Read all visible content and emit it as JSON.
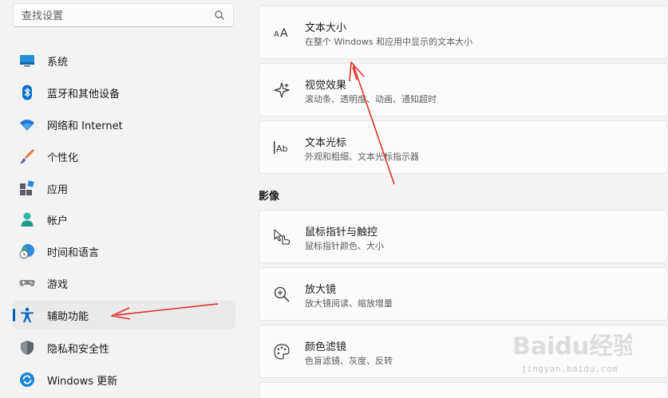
{
  "search": {
    "placeholder": "查找设置"
  },
  "sidebar": {
    "items": [
      {
        "label": "系统",
        "icon": "display-icon"
      },
      {
        "label": "蓝牙和其他设备",
        "icon": "bluetooth-icon"
      },
      {
        "label": "网络和 Internet",
        "icon": "wifi-icon"
      },
      {
        "label": "个性化",
        "icon": "brush-icon"
      },
      {
        "label": "应用",
        "icon": "apps-icon"
      },
      {
        "label": "帐户",
        "icon": "person-icon"
      },
      {
        "label": "时间和语言",
        "icon": "globe-clock-icon"
      },
      {
        "label": "游戏",
        "icon": "gamepad-icon"
      },
      {
        "label": "辅助功能",
        "icon": "accessibility-icon",
        "selected": true
      },
      {
        "label": "隐私和安全性",
        "icon": "shield-icon"
      },
      {
        "label": "Windows 更新",
        "icon": "update-icon"
      }
    ]
  },
  "main": {
    "cards_top": [
      {
        "title": "文本大小",
        "subtitle": "在整个 Windows 和应用中显示的文本大小",
        "icon": "text-size-icon"
      },
      {
        "title": "视觉效果",
        "subtitle": "滚动条、透明度、动画、通知超时",
        "icon": "sparkle-icon"
      },
      {
        "title": "文本光标",
        "subtitle": "外观和粗细、文本光标指示器",
        "icon": "text-cursor-icon"
      }
    ],
    "section_title": "影像",
    "cards_bottom": [
      {
        "title": "鼠标指针与触控",
        "subtitle": "鼠标指针颜色、大小",
        "icon": "pointer-touch-icon"
      },
      {
        "title": "放大镜",
        "subtitle": "放大镜阅读、缩放增量",
        "icon": "magnifier-icon"
      },
      {
        "title": "颜色滤镜",
        "subtitle": "色盲滤镜、灰度、反转",
        "icon": "palette-icon"
      }
    ]
  },
  "watermark": {
    "brand": "Baidu经验",
    "url": "jingyan.baidu.com"
  },
  "colors": {
    "accent": "#005fb8",
    "annotation_arrow": "#e0312f",
    "background": "#f3f3f3",
    "card": "#fbfbfb"
  }
}
